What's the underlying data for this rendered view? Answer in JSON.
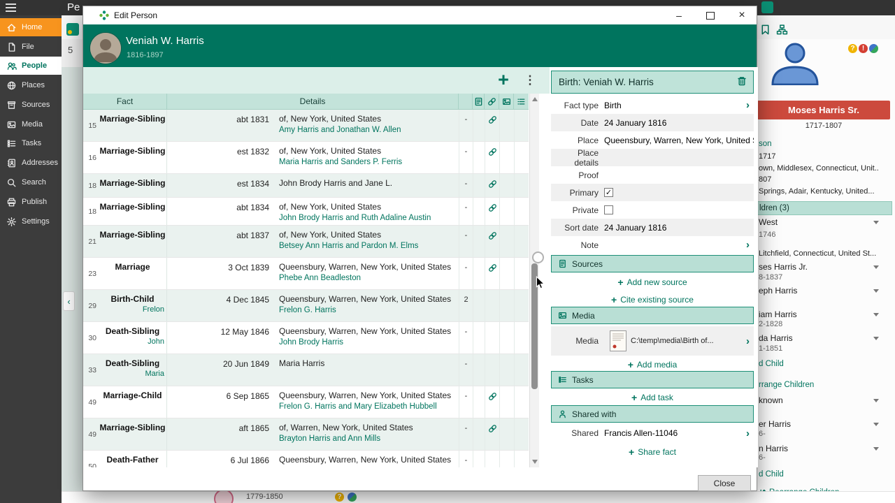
{
  "icons": {
    "plus": "+",
    "kebab": "⋮",
    "minimize": "–",
    "close": "×",
    "check": "✓",
    "chevron_right": "›",
    "collapse_left": "‹",
    "question": "?",
    "exclamation": "!"
  },
  "topbar": {
    "partial_text": "Pe"
  },
  "sidebar": {
    "items": [
      {
        "label": "Home"
      },
      {
        "label": "File"
      },
      {
        "label": "People"
      },
      {
        "label": "Places"
      },
      {
        "label": "Sources"
      },
      {
        "label": "Media"
      },
      {
        "label": "Tasks"
      },
      {
        "label": "Addresses"
      },
      {
        "label": "Search"
      },
      {
        "label": "Publish"
      },
      {
        "label": "Settings"
      }
    ]
  },
  "strip": {
    "count": "5"
  },
  "bg": {
    "person": {
      "name": "Moses Harris Sr.",
      "dates": "1717-1807"
    },
    "tree": [
      {
        "text": "son"
      },
      {
        "text": "1717"
      },
      {
        "text": "own, Middlesex, Connecticut, Unit..."
      },
      {
        "text": "807"
      },
      {
        "text": "Springs, Adair, Kentucky, United..."
      },
      {
        "text": "ldren (3)"
      },
      {
        "text": "West"
      },
      {
        "text": "1746"
      },
      {
        "text": "Litchfield, Connecticut, United St..."
      },
      {
        "text": "ses Harris Jr."
      },
      {
        "text": "8-1837"
      },
      {
        "text": "eph Harris"
      },
      {
        "text": "iam Harris"
      },
      {
        "text": "2-1828"
      },
      {
        "text": "da Harris"
      },
      {
        "text": "1-1851"
      },
      {
        "text": "d Child"
      },
      {
        "text": "rrange Children"
      },
      {
        "text": "known"
      },
      {
        "text": "er Harris"
      },
      {
        "text": "6-"
      },
      {
        "text": "n Harris"
      },
      {
        "text": "6-"
      },
      {
        "text": "d Child"
      },
      {
        "text": "Rearrange Children"
      }
    ],
    "bottom_dates": "1779-1850"
  },
  "dialog": {
    "title": "Edit Person",
    "person": {
      "name": "Veniah W. Harris",
      "dates": "1816-1897"
    },
    "table": {
      "header_fact": "Fact",
      "header_details": "Details",
      "rows": [
        {
          "num": "15",
          "fact": "Marriage-Sibling",
          "sub": "",
          "date": "abt 1831",
          "d1": "of, New York, United States",
          "d2": "Amy Harris and Jonathan W. Allen",
          "x": "-"
        },
        {
          "num": "16",
          "fact": "Marriage-Sibling",
          "sub": "",
          "date": "est 1832",
          "d1": "of, New York, United States",
          "d2": "Maria Harris and Sanders P. Ferris",
          "x": "-"
        },
        {
          "num": "18",
          "fact": "Marriage-Sibling",
          "sub": "",
          "date": "est 1834",
          "d1": "John Brody Harris and Jane L.",
          "d2": "",
          "x": "-"
        },
        {
          "num": "18",
          "fact": "Marriage-Sibling",
          "sub": "",
          "date": "abt 1834",
          "d1": "of, New York, United States",
          "d2": "John Brody Harris and Ruth Adaline Austin",
          "x": "-"
        },
        {
          "num": "21",
          "fact": "Marriage-Sibling",
          "sub": "",
          "date": "abt 1837",
          "d1": "of, New York, United States",
          "d2": "Betsey Ann Harris and Pardon M. Elms",
          "x": "-"
        },
        {
          "num": "23",
          "fact": "Marriage",
          "sub": "",
          "date": "3 Oct 1839",
          "d1": "Queensbury, Warren, New York, United States",
          "d2": "Phebe Ann Beadleston",
          "x": "-"
        },
        {
          "num": "29",
          "fact": "Birth-Child",
          "sub": "Frelon",
          "date": "4 Dec 1845",
          "d1": "Queensbury, Warren, New York, United States",
          "d2": "Frelon G. Harris",
          "x": "2"
        },
        {
          "num": "30",
          "fact": "Death-Sibling",
          "sub": "John",
          "date": "12 May 1846",
          "d1": "Queensbury, Warren, New York, United States",
          "d2": "John Brody Harris",
          "x": "-"
        },
        {
          "num": "33",
          "fact": "Death-Sibling",
          "sub": "Maria",
          "date": "20 Jun 1849",
          "d1": "Maria Harris",
          "d2": "",
          "x": "-"
        },
        {
          "num": "49",
          "fact": "Marriage-Child",
          "sub": "",
          "date": "6 Sep 1865",
          "d1": "Queensbury, Warren, New York, United States",
          "d2": "Frelon G. Harris and Mary Elizabeth Hubbell",
          "x": "-"
        },
        {
          "num": "49",
          "fact": "Marriage-Sibling",
          "sub": "",
          "date": "aft 1865",
          "d1": "of, Warren, New York, United States",
          "d2": "Brayton Harris and Ann Mills",
          "x": "-"
        },
        {
          "num": "50",
          "fact": "Death-Father",
          "sub": "",
          "date": "6 Jul 1866",
          "d1": "Queensbury, Warren, New York, United States",
          "d2": "",
          "x": "-"
        }
      ]
    },
    "panel": {
      "title": "Birth: Veniah W. Harris",
      "fact_type_label": "Fact type",
      "fact_type": "Birth",
      "date_label": "Date",
      "date": "24 January 1816",
      "place_label": "Place",
      "place": "Queensbury, Warren, New York, United States",
      "place_details_label": "Place details",
      "place_details": "",
      "proof_label": "Proof",
      "proof": "",
      "primary_label": "Primary",
      "private_label": "Private",
      "sort_date_label": "Sort date",
      "sort_date": "24 January 1816",
      "note_label": "Note",
      "sources_title": "Sources",
      "add_new_source": "Add new source",
      "cite_existing_source": "Cite existing source",
      "media_title": "Media",
      "media_label": "Media",
      "media_path": "C:\\temp\\media\\Birth of...",
      "add_media": "Add media",
      "tasks_title": "Tasks",
      "add_task": "Add task",
      "shared_title": "Shared with",
      "shared_label": "Shared",
      "shared_value": "Francis Allen-11046",
      "share_fact": "Share fact"
    },
    "close_label": "Close"
  }
}
